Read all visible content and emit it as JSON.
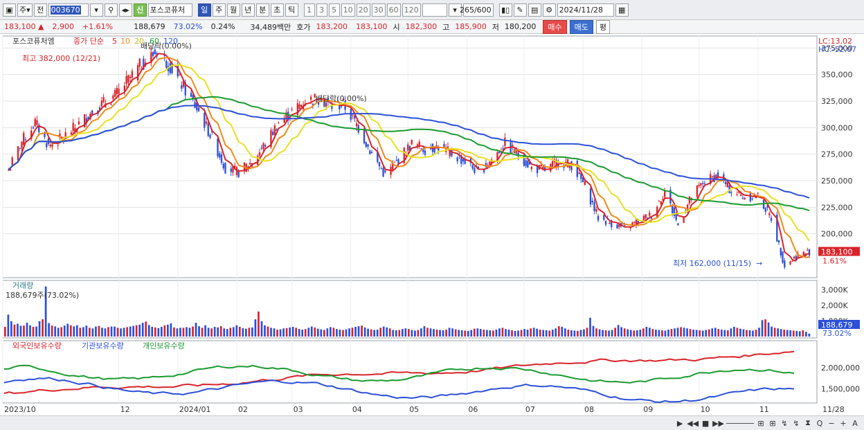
{
  "toolbar": {
    "period_mode": "주",
    "prev_label": "전",
    "code": "003670",
    "credit_badge": "신",
    "stock_name": "포스코퓨처",
    "periods": [
      "일",
      "주",
      "월",
      "년",
      "분",
      "초",
      "틱"
    ],
    "active_period": "일",
    "intervals": [
      "1",
      "3",
      "5",
      "10",
      "20",
      "30",
      "60",
      "120"
    ],
    "count_display": "265/600",
    "date": "2024/11/28"
  },
  "quote": {
    "price": "183,100",
    "change": "2,900",
    "change_pct": "+1.61%",
    "volume": "188,679",
    "volume_ratio": "73.02%",
    "turnover_rate": "0.24%",
    "amount": "34,489백만",
    "ask_label": "호가",
    "ask": "183,200",
    "bid": "183,100",
    "open_label": "시",
    "open": "182,300",
    "high_label": "고",
    "high": "185,900",
    "low_label": "저",
    "low": "180,200",
    "buy_label": "매수",
    "sell_label": "매도",
    "eval_label": "평"
  },
  "chart_data": [
    {
      "type": "candlestick",
      "title": "포스코퓨처엠",
      "legend": {
        "price_label": "종가 단순",
        "ma": [
          "5",
          "10",
          "20",
          "60",
          "120"
        ]
      },
      "ma_colors": {
        "5": "#d8232a",
        "10": "#f08a18",
        "20": "#e8e020",
        "60": "#1a9a30",
        "120": "#2b4fd8"
      },
      "ylim": [
        160000,
        385000
      ],
      "y_ticks": [
        "375,000",
        "350,000",
        "325,000",
        "300,000",
        "275,000",
        "250,000",
        "225,000",
        "200,000"
      ],
      "x_ticks": [
        "2023/10",
        "12",
        "2024/01",
        "02",
        "03",
        "04",
        "05",
        "06",
        "07",
        "08",
        "09",
        "10",
        "11"
      ],
      "x_end_label": "11/28",
      "right_header": [
        "LC:13.02",
        "HC:-52.07"
      ],
      "current_price_label": "183,100",
      "current_change_label": "1.61%",
      "annotations": [
        {
          "text": "배당락(0.00%)",
          "date": "2023/12/27"
        },
        {
          "text": "최고 382,000 (12/21)",
          "date": "2023/12/21",
          "value": 382000
        },
        {
          "text": "배당락(0.00%)",
          "date": "2024/03/28"
        },
        {
          "text": "최저 162,000 (11/15)",
          "date": "2024/11/15",
          "value": 162000
        }
      ],
      "close_series": [
        {
          "date": "2023/10/04",
          "close": 260000
        },
        {
          "date": "2023/10/11",
          "close": 287000
        },
        {
          "date": "2023/10/18",
          "close": 305000
        },
        {
          "date": "2023/10/25",
          "close": 283000
        },
        {
          "date": "2023/11/01",
          "close": 290000
        },
        {
          "date": "2023/11/08",
          "close": 300000
        },
        {
          "date": "2023/11/15",
          "close": 312000
        },
        {
          "date": "2023/11/22",
          "close": 322000
        },
        {
          "date": "2023/11/29",
          "close": 330000
        },
        {
          "date": "2023/12/06",
          "close": 345000
        },
        {
          "date": "2023/12/13",
          "close": 360000
        },
        {
          "date": "2023/12/21",
          "close": 372000
        },
        {
          "date": "2023/12/28",
          "close": 358000
        },
        {
          "date": "2024/01/05",
          "close": 335000
        },
        {
          "date": "2024/01/12",
          "close": 315000
        },
        {
          "date": "2024/01/19",
          "close": 290000
        },
        {
          "date": "2024/01/26",
          "close": 262000
        },
        {
          "date": "2024/02/02",
          "close": 258000
        },
        {
          "date": "2024/02/09",
          "close": 268000
        },
        {
          "date": "2024/02/16",
          "close": 285000
        },
        {
          "date": "2024/02/23",
          "close": 305000
        },
        {
          "date": "2024/03/01",
          "close": 315000
        },
        {
          "date": "2024/03/08",
          "close": 325000
        },
        {
          "date": "2024/03/15",
          "close": 328000
        },
        {
          "date": "2024/03/22",
          "close": 320000
        },
        {
          "date": "2024/03/28",
          "close": 322000
        },
        {
          "date": "2024/04/05",
          "close": 300000
        },
        {
          "date": "2024/04/12",
          "close": 275000
        },
        {
          "date": "2024/04/19",
          "close": 255000
        },
        {
          "date": "2024/04/26",
          "close": 270000
        },
        {
          "date": "2024/05/03",
          "close": 285000
        },
        {
          "date": "2024/05/10",
          "close": 280000
        },
        {
          "date": "2024/05/17",
          "close": 282000
        },
        {
          "date": "2024/05/24",
          "close": 275000
        },
        {
          "date": "2024/05/31",
          "close": 268000
        },
        {
          "date": "2024/06/07",
          "close": 258000
        },
        {
          "date": "2024/06/14",
          "close": 270000
        },
        {
          "date": "2024/06/21",
          "close": 285000
        },
        {
          "date": "2024/06/28",
          "close": 275000
        },
        {
          "date": "2024/07/05",
          "close": 262000
        },
        {
          "date": "2024/07/12",
          "close": 260000
        },
        {
          "date": "2024/07/19",
          "close": 268000
        },
        {
          "date": "2024/07/26",
          "close": 265000
        },
        {
          "date": "2024/08/02",
          "close": 245000
        },
        {
          "date": "2024/08/09",
          "close": 215000
        },
        {
          "date": "2024/08/16",
          "close": 210000
        },
        {
          "date": "2024/08/23",
          "close": 205000
        },
        {
          "date": "2024/08/30",
          "close": 212000
        },
        {
          "date": "2024/09/06",
          "close": 218000
        },
        {
          "date": "2024/09/13",
          "close": 240000
        },
        {
          "date": "2024/09/20",
          "close": 208000
        },
        {
          "date": "2024/09/27",
          "close": 235000
        },
        {
          "date": "2024/10/04",
          "close": 250000
        },
        {
          "date": "2024/10/11",
          "close": 255000
        },
        {
          "date": "2024/10/18",
          "close": 240000
        },
        {
          "date": "2024/10/25",
          "close": 235000
        },
        {
          "date": "2024/11/01",
          "close": 235000
        },
        {
          "date": "2024/11/08",
          "close": 215000
        },
        {
          "date": "2024/11/15",
          "close": 170000
        },
        {
          "date": "2024/11/22",
          "close": 180000
        },
        {
          "date": "2024/11/28",
          "close": 183100
        }
      ]
    },
    {
      "type": "bar",
      "title": "거래량",
      "subtitle": "188,679주(73.02%)",
      "y_ticks": [
        "3,000K",
        "2,000K",
        "1,000K"
      ],
      "current_label": "188,679",
      "current_pct_label": "73.02%",
      "volume_k": [
        620,
        1400,
        980,
        760,
        820,
        690,
        700,
        880,
        720,
        620,
        640,
        980,
        1100,
        3200,
        860,
        700,
        650,
        560,
        600,
        700,
        820,
        720,
        650,
        720,
        560,
        600,
        700,
        560,
        520,
        640,
        680,
        560,
        520,
        600,
        640,
        640,
        560,
        520,
        560,
        600,
        640,
        680,
        720,
        760,
        880,
        960,
        740,
        620,
        580,
        540,
        620,
        720,
        760,
        840,
        580,
        520,
        560,
        560,
        600,
        560,
        640,
        880,
        660,
        560,
        720,
        560,
        520,
        620,
        580,
        660,
        520,
        480,
        560,
        600,
        720,
        620,
        540,
        500,
        560,
        580,
        1100,
        1600,
        980,
        720,
        640,
        560,
        520,
        440,
        460,
        520,
        540,
        580,
        620,
        560,
        480,
        440,
        480,
        560,
        640,
        580,
        500,
        460,
        420,
        520,
        600,
        560,
        480,
        440,
        420,
        460,
        520,
        560,
        620,
        660,
        700,
        580,
        500,
        460,
        420,
        440,
        560,
        640,
        580,
        520,
        420,
        400,
        420,
        480,
        520,
        480,
        420,
        380,
        420,
        520,
        660,
        560,
        520,
        480,
        440,
        420,
        400,
        440,
        560,
        520,
        460,
        420,
        400,
        380,
        360,
        420,
        500,
        520,
        480,
        440,
        420,
        400,
        380,
        440,
        520,
        560,
        480,
        440,
        400,
        360,
        380,
        420,
        480,
        440,
        520,
        560,
        500,
        440,
        420,
        400,
        380,
        440,
        520,
        660,
        620,
        520,
        440,
        400,
        380,
        360,
        420,
        460,
        560,
        1200,
        680,
        520,
        460,
        420,
        400,
        380,
        420,
        560,
        740,
        600,
        520,
        460,
        420,
        380,
        400,
        440,
        520,
        620,
        560,
        480,
        440,
        420,
        400,
        380,
        440,
        480,
        520,
        560,
        600,
        560,
        520,
        480,
        440,
        420,
        400,
        380,
        420,
        460,
        520,
        560,
        480,
        440,
        420,
        400,
        520,
        620,
        560,
        500,
        460,
        420,
        400,
        380,
        440,
        560,
        1050,
        1100,
        900,
        640,
        560,
        520,
        480,
        440,
        420,
        400,
        380,
        360,
        340,
        400,
        300,
        189
      ]
    },
    {
      "type": "line",
      "legend": [
        "외국인보유수량",
        "기관보유수량",
        "개인보유수량"
      ],
      "series_colors": [
        "#d8232a",
        "#2b4fd8",
        "#1a9a30"
      ],
      "y_ticks": [
        "2,000,000",
        "1,500,000"
      ],
      "ylim": [
        1200000,
        2600000
      ]
    }
  ],
  "bottombar": {
    "icons": [
      "▶",
      "◀◀",
      "■",
      "▶▶",
      "—",
      "⊞",
      "⊞",
      "↯",
      "↯",
      "⧗",
      "Q",
      "−",
      "+",
      "A"
    ]
  }
}
